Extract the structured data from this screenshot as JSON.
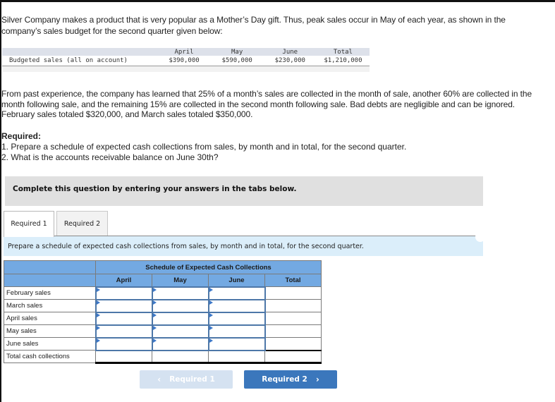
{
  "intro": "Silver Company makes a product that is very popular as a Mother’s Day gift. Thus, peak sales occur in May of each year, as shown in the company’s sales budget for the second quarter given below:",
  "budget": {
    "headers": [
      "April",
      "May",
      "June",
      "Total"
    ],
    "row_label": "Budgeted sales (all on account)",
    "values": [
      "$390,000",
      "$590,000",
      "$230,000",
      "$1,210,000"
    ]
  },
  "past_experience": "From past experience, the company has learned that 25% of a month’s sales are collected in the month of sale, another 60% are collected in the month following sale, and the remaining 15% are collected in the second month following sale. Bad debts are negligible and can be ignored. February sales totaled $320,000, and March sales totaled $350,000.",
  "required": {
    "heading": "Required:",
    "items": [
      "1. Prepare a schedule of expected cash collections from sales, by month and in total, for the second quarter.",
      "2. What is the accounts receivable balance on June 30th?"
    ]
  },
  "instruction": "Complete this question by entering your answers in the tabs below.",
  "tabs": [
    {
      "label": "Required 1",
      "active": true
    },
    {
      "label": "Required 2",
      "active": false
    }
  ],
  "prompt": "Prepare a schedule of expected cash collections from sales, by month and in total, for the second quarter.",
  "schedule": {
    "title": "Schedule of Expected Cash Collections",
    "columns": [
      "April",
      "May",
      "June",
      "Total"
    ],
    "rows": [
      {
        "label": "February sales",
        "values": [
          "",
          "",
          "",
          ""
        ]
      },
      {
        "label": "March sales",
        "values": [
          "",
          "",
          "",
          ""
        ]
      },
      {
        "label": "April sales",
        "values": [
          "",
          "",
          "",
          ""
        ]
      },
      {
        "label": "May sales",
        "values": [
          "",
          "",
          "",
          ""
        ]
      },
      {
        "label": "June sales",
        "values": [
          "",
          "",
          "",
          ""
        ]
      }
    ],
    "total_row": {
      "label": "Total cash collections",
      "values": [
        "",
        "",
        "",
        ""
      ]
    }
  },
  "nav": {
    "prev_label": "Required 1",
    "prev_icon": "chevron-left-icon",
    "next_label": "Required 2",
    "next_icon": "chevron-right-icon"
  },
  "colors": {
    "schedule_header": "#73a9e2",
    "next_button": "#3b77bc",
    "prev_button_disabled": "#d5e2f1",
    "prompt_band": "#dbeefa",
    "instruction_box": "#e0e0e0"
  }
}
